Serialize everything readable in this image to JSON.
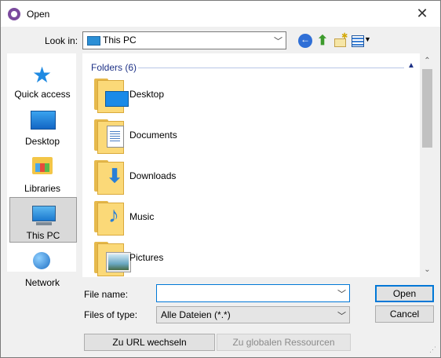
{
  "window": {
    "title": "Open",
    "close_symbol": "✕"
  },
  "toolbar": {
    "look_in_label": "Look in:",
    "look_in_value": "This PC",
    "icons": [
      "back-icon",
      "up-folder-icon",
      "new-folder-icon",
      "view-menu-icon"
    ]
  },
  "places": [
    {
      "label": "Quick access",
      "icon": "quick-access-icon",
      "selected": false
    },
    {
      "label": "Desktop",
      "icon": "desktop-icon",
      "selected": false
    },
    {
      "label": "Libraries",
      "icon": "libraries-icon",
      "selected": false
    },
    {
      "label": "This PC",
      "icon": "this-pc-icon",
      "selected": true
    },
    {
      "label": "Network",
      "icon": "network-icon",
      "selected": false
    }
  ],
  "file_list": {
    "group_header": "Folders (6)",
    "items": [
      {
        "label": "Desktop",
        "icon": "desktop-folder-icon"
      },
      {
        "label": "Documents",
        "icon": "documents-folder-icon"
      },
      {
        "label": "Downloads",
        "icon": "downloads-folder-icon"
      },
      {
        "label": "Music",
        "icon": "music-folder-icon"
      },
      {
        "label": "Pictures",
        "icon": "pictures-folder-icon"
      }
    ]
  },
  "form": {
    "file_name_label": "File name:",
    "file_name_value": "",
    "file_type_label": "Files of type:",
    "file_type_value": "Alle Dateien (*.*)"
  },
  "buttons": {
    "open": "Open",
    "cancel": "Cancel",
    "to_url": "Zu URL wechseln",
    "to_global": "Zu globalen Ressourcen"
  },
  "colors": {
    "accent": "#0078d7",
    "group_header": "#1e3287",
    "folder": "#fbd978"
  }
}
